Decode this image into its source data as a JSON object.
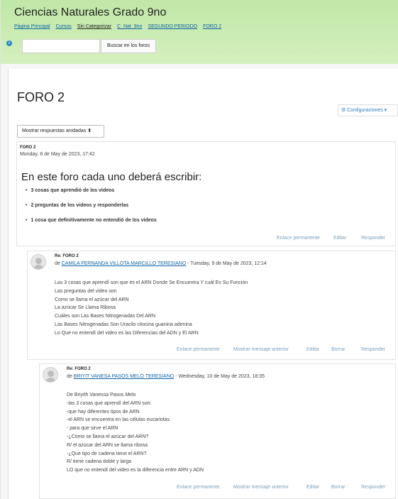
{
  "course_title": "Ciencias Naturales Grado 9no",
  "breadcrumb": [
    "Página Principal",
    "Cursos",
    "Sin Categorizar",
    "C_Nat_9no",
    "SEGUNDO PERIODO",
    "FORO 2"
  ],
  "search": {
    "button_label": "Buscar en los foros",
    "value": ""
  },
  "page_title": "FORO 2",
  "settings_label": "Configuraciones",
  "display_mode": "Mostrar respuestas anidadas",
  "icons": {
    "info": "info-icon",
    "settings": "gear-icon",
    "dropdown": "caret-down-icon",
    "select": "up-down-arrows-icon",
    "avatar": "default-user-icon"
  },
  "post": {
    "subject": "FORO 2",
    "date": "Monday, 8 de May de 2023, 17:42",
    "heading": "En  este foro cada uno deberá escribir:",
    "items": [
      "3 cosas que aprendió de los videos",
      "2 preguntas de los videos y responderlas",
      "1 cosa que definitivamente no entendió de los videos"
    ],
    "actions": {
      "permalink": "Enlace permanente",
      "edit": "Editar",
      "reply": "Responder"
    }
  },
  "replies": [
    {
      "subject": "Re: FORO 2",
      "by": "de ",
      "author": "CAMILA FERNANDA VILLOTA MARCILLO TERESIANO",
      "date": " - Tuesday, 9 de May de 2023, 12:14",
      "lines": [
        "Las 3 cosas que aprendí son que es el ARN Donde Se Encuentra Y cuál Es Su Función",
        "Las preguntas del video son",
        "Como se llama el azúcar del ARN",
        "La azúcar Se Llama Ribosa",
        "Cuáles son Las Bases Nitrogenadas Del ARN",
        "Las Bases Nitrogenadas Son Uracilo citocina guanina adenina",
        "Lo Que no entendí del video es las Diferencias del ADN y El ARN"
      ],
      "actions": {
        "permalink": "Enlace permanente",
        "parent": "Mostrar mensaje anterior",
        "edit": "Editar",
        "delete": "Borrar",
        "reply": "Responder"
      }
    },
    {
      "subject": "Re: FORO 2",
      "by": "de ",
      "author": "BRIYIT VANESA PASOS MELO TERESIANO",
      "date": " - Wednesday, 10 de May de 2023, 18:35",
      "lines": [
        "De Briyith Vanessa Pasos Melo",
        "-las 3 cosas que aprendí del ARN son:",
        "-que hay diferentes tipos de ARN",
        "-el ARN se encuentra en las células eucariotas",
        "- para que sirve el ARN",
        "-¿Cómo se llama el azúcar del ARN?",
        "R/ el azúcar del ARN se llama ribosa",
        "-¿Que tipo de cadena tiene el ARN?",
        "R/ tiene cadena doble y larga",
        "LO que no entendí del video es la diferencia entre ARN y ADN"
      ],
      "actions": {
        "permalink": "Enlace permanente",
        "parent": "Mostrar mensaje anterior",
        "edit": "Editar",
        "delete": "Borrar",
        "reply": "Responder"
      }
    }
  ]
}
